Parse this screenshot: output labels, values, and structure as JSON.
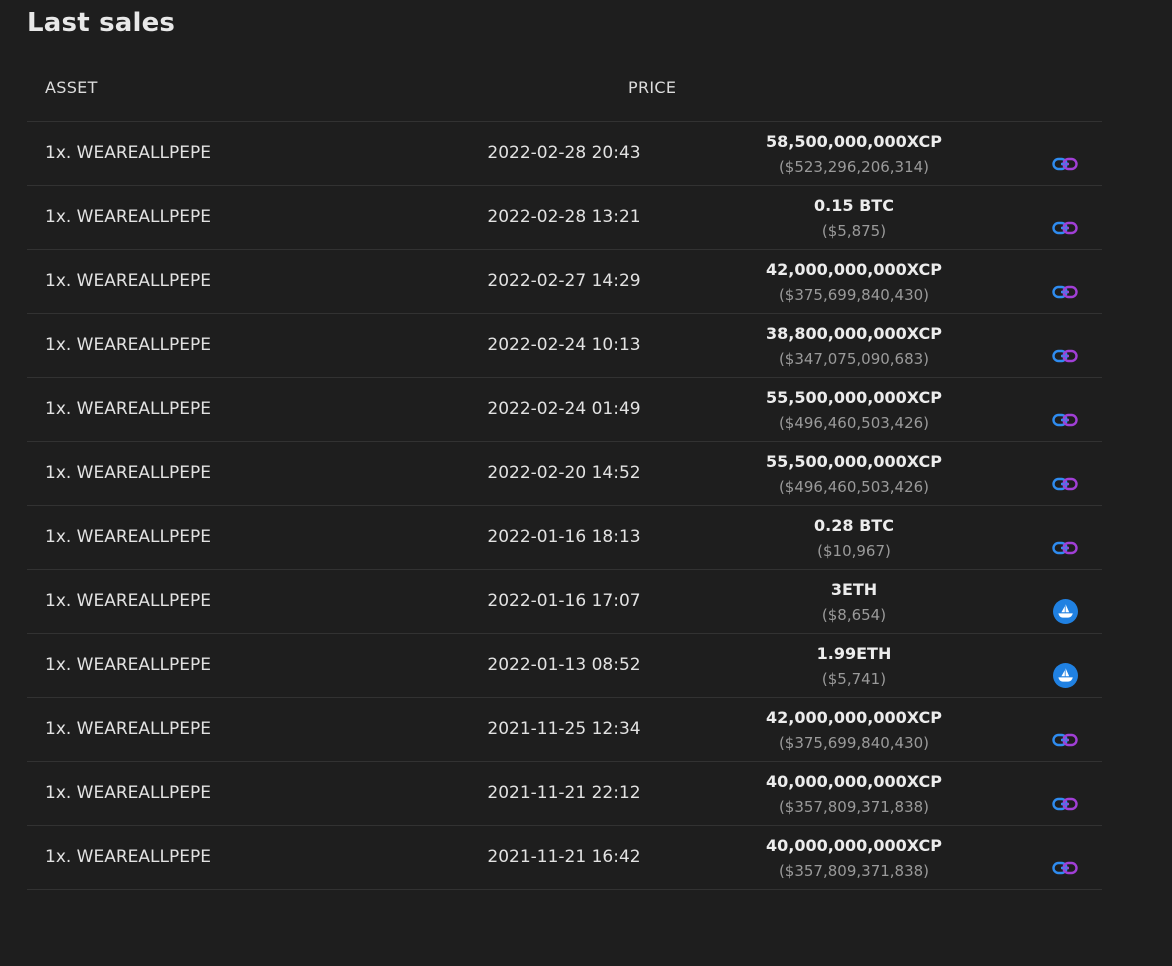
{
  "page": {
    "title": "Last sales"
  },
  "table": {
    "headers": {
      "asset": "ASSET",
      "price": "PRICE"
    },
    "rows": [
      {
        "asset": "1x. WEAREALLPEPE",
        "date": "2022-02-28 20:43",
        "price": "58,500,000,000XCP",
        "usd": "($523,296,206,314)",
        "market_icon": "chain-link-icon"
      },
      {
        "asset": "1x. WEAREALLPEPE",
        "date": "2022-02-28 13:21",
        "price": "0.15 BTC",
        "usd": "($5,875)",
        "market_icon": "chain-link-icon"
      },
      {
        "asset": "1x. WEAREALLPEPE",
        "date": "2022-02-27 14:29",
        "price": "42,000,000,000XCP",
        "usd": "($375,699,840,430)",
        "market_icon": "chain-link-icon"
      },
      {
        "asset": "1x. WEAREALLPEPE",
        "date": "2022-02-24 10:13",
        "price": "38,800,000,000XCP",
        "usd": "($347,075,090,683)",
        "market_icon": "chain-link-icon"
      },
      {
        "asset": "1x. WEAREALLPEPE",
        "date": "2022-02-24 01:49",
        "price": "55,500,000,000XCP",
        "usd": "($496,460,503,426)",
        "market_icon": "chain-link-icon"
      },
      {
        "asset": "1x. WEAREALLPEPE",
        "date": "2022-02-20 14:52",
        "price": "55,500,000,000XCP",
        "usd": "($496,460,503,426)",
        "market_icon": "chain-link-icon"
      },
      {
        "asset": "1x. WEAREALLPEPE",
        "date": "2022-01-16 18:13",
        "price": "0.28 BTC",
        "usd": "($10,967)",
        "market_icon": "chain-link-icon"
      },
      {
        "asset": "1x. WEAREALLPEPE",
        "date": "2022-01-16 17:07",
        "price": "3ETH",
        "usd": "($8,654)",
        "market_icon": "opensea-icon"
      },
      {
        "asset": "1x. WEAREALLPEPE",
        "date": "2022-01-13 08:52",
        "price": "1.99ETH",
        "usd": "($5,741)",
        "market_icon": "opensea-icon"
      },
      {
        "asset": "1x. WEAREALLPEPE",
        "date": "2021-11-25 12:34",
        "price": "42,000,000,000XCP",
        "usd": "($375,699,840,430)",
        "market_icon": "chain-link-icon"
      },
      {
        "asset": "1x. WEAREALLPEPE",
        "date": "2021-11-21 22:12",
        "price": "40,000,000,000XCP",
        "usd": "($357,809,371,838)",
        "market_icon": "chain-link-icon"
      },
      {
        "asset": "1x. WEAREALLPEPE",
        "date": "2021-11-21 16:42",
        "price": "40,000,000,000XCP",
        "usd": "($357,809,371,838)",
        "market_icon": "chain-link-icon"
      }
    ]
  },
  "colors": {
    "background": "#1e1e1e",
    "row_divider": "#323232",
    "link_icon_blue": "#2f8cf0",
    "link_icon_purple": "#a13fd6",
    "opensea_blue": "#2081e2"
  }
}
